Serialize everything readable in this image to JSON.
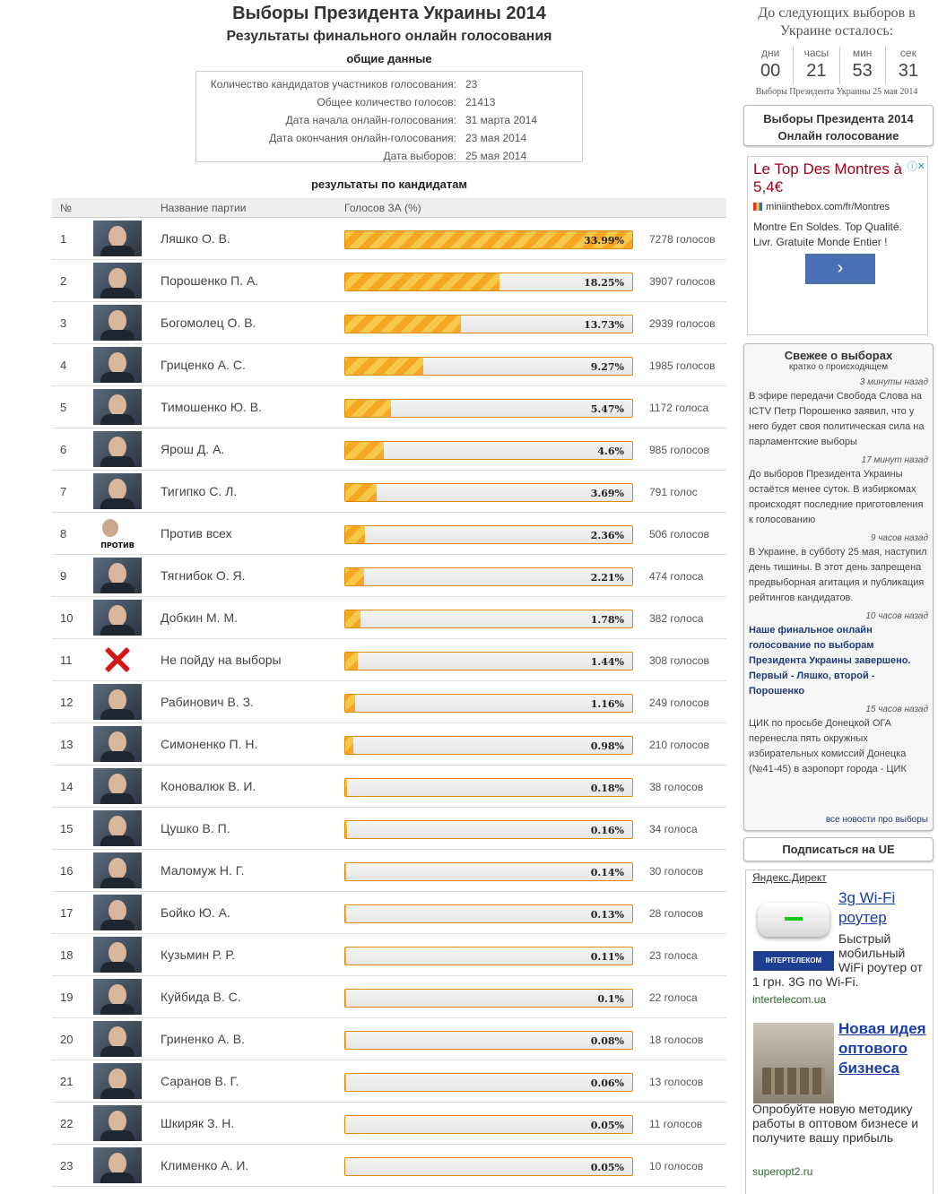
{
  "header": {
    "title": "Выборы Президента Украины 2014",
    "subtitle": "Результаты финального онлайн голосования",
    "general_label": "общие данные",
    "results_label": "результаты по кандидатам"
  },
  "general": [
    {
      "k": "Количество кандидатов участников голосования:",
      "v": "23"
    },
    {
      "k": "Общее количество голосов:",
      "v": "21413"
    },
    {
      "k": "Дата начала онлайн-голосования:",
      "v": "31 марта 2014"
    },
    {
      "k": "Дата окончания онлайн-голосования:",
      "v": "23 мая 2014"
    },
    {
      "k": "Дата выборов:",
      "v": "25 мая 2014"
    }
  ],
  "table": {
    "col_num": "№",
    "col_party": "Название партии",
    "col_votes": "Голосов ЗА (%)"
  },
  "candidates": [
    {
      "num": "1",
      "name": "Ляшко О. В.",
      "pct": 33.99,
      "pct_label": "33.99%",
      "votes": "7278 голосов"
    },
    {
      "num": "2",
      "name": "Порошенко П. А.",
      "pct": 18.25,
      "pct_label": "18.25%",
      "votes": "3907 голосов"
    },
    {
      "num": "3",
      "name": "Богомолец О. В.",
      "pct": 13.73,
      "pct_label": "13.73%",
      "votes": "2939 голосов"
    },
    {
      "num": "4",
      "name": "Гриценко А. С.",
      "pct": 9.27,
      "pct_label": "9.27%",
      "votes": "1985 голосов"
    },
    {
      "num": "5",
      "name": "Тимошенко Ю. В.",
      "pct": 5.47,
      "pct_label": "5.47%",
      "votes": "1172 голоса"
    },
    {
      "num": "6",
      "name": "Ярош Д. А.",
      "pct": 4.6,
      "pct_label": "4.6%",
      "votes": "985 голосов"
    },
    {
      "num": "7",
      "name": "Тигипко С. Л.",
      "pct": 3.69,
      "pct_label": "3.69%",
      "votes": "791 голос"
    },
    {
      "num": "8",
      "name": "Против всех",
      "pct": 2.36,
      "pct_label": "2.36%",
      "votes": "506 голосов",
      "photo": "against"
    },
    {
      "num": "9",
      "name": "Тягнибок О. Я.",
      "pct": 2.21,
      "pct_label": "2.21%",
      "votes": "474 голоса"
    },
    {
      "num": "10",
      "name": "Добкин М. М.",
      "pct": 1.78,
      "pct_label": "1.78%",
      "votes": "382 голоса"
    },
    {
      "num": "11",
      "name": "Не пойду на выборы",
      "pct": 1.44,
      "pct_label": "1.44%",
      "votes": "308 голосов",
      "photo": "red-x"
    },
    {
      "num": "12",
      "name": "Рабинович В. З.",
      "pct": 1.16,
      "pct_label": "1.16%",
      "votes": "249 голосов"
    },
    {
      "num": "13",
      "name": "Симоненко П. Н.",
      "pct": 0.98,
      "pct_label": "0.98%",
      "votes": "210 голосов"
    },
    {
      "num": "14",
      "name": "Коновалюк В. И.",
      "pct": 0.18,
      "pct_label": "0.18%",
      "votes": "38 голосов"
    },
    {
      "num": "15",
      "name": "Цушко В. П.",
      "pct": 0.16,
      "pct_label": "0.16%",
      "votes": "34 голоса"
    },
    {
      "num": "16",
      "name": "Маломуж Н. Г.",
      "pct": 0.14,
      "pct_label": "0.14%",
      "votes": "30 голосов"
    },
    {
      "num": "17",
      "name": "Бойко Ю. А.",
      "pct": 0.13,
      "pct_label": "0.13%",
      "votes": "28 голосов"
    },
    {
      "num": "18",
      "name": "Кузьмин Р. Р.",
      "pct": 0.11,
      "pct_label": "0.11%",
      "votes": "23 голоса"
    },
    {
      "num": "19",
      "name": "Куйбида В. С.",
      "pct": 0.1,
      "pct_label": "0.1%",
      "votes": "22 голоса"
    },
    {
      "num": "20",
      "name": "Гриненко А. В.",
      "pct": 0.08,
      "pct_label": "0.08%",
      "votes": "18 голосов"
    },
    {
      "num": "21",
      "name": "Саранов В. Г.",
      "pct": 0.06,
      "pct_label": "0.06%",
      "votes": "13 голосов"
    },
    {
      "num": "22",
      "name": "Шкиряк З. Н.",
      "pct": 0.05,
      "pct_label": "0.05%",
      "votes": "11 голосов"
    },
    {
      "num": "23",
      "name": "Клименко А. И.",
      "pct": 0.05,
      "pct_label": "0.05%",
      "votes": "10 голосов"
    }
  ],
  "against_caption": "ПРОТИВ ВСЕХ",
  "sidebar": {
    "countdown_title": "До следующих выборов в Украине осталось:",
    "countdown": [
      {
        "unit": "дни",
        "value": "00"
      },
      {
        "unit": "часы",
        "value": "21"
      },
      {
        "unit": "мин",
        "value": "53"
      },
      {
        "unit": "сек",
        "value": "31"
      }
    ],
    "countdown_caption": "Выборы Президента Украины 25 мая 2014",
    "vote_box": "Выборы Президента 2014 Онлайн голосование",
    "ad": {
      "title": "Le Top Des Montres à 5,4€",
      "url": "miniinthebox.com/fr/Montres",
      "text": "Montre En Soldes. Top Qualité. Livr. Gratuite Monde Entier !",
      "go": "›",
      "close": "ⓘ✕"
    },
    "news_title": "Свежее о выборах",
    "news_sub": "кратко о происходящем",
    "news": [
      {
        "time": "3 минуты назад",
        "text": "В эфире передачи Свобода Слова на ICTV Петр Порошенко заявил, что у него будет своя политическая сила на парламентские выборы",
        "bold": false
      },
      {
        "time": "17 минут назад",
        "text": "До выборов Президента Украины остаётся менее суток. В избиркомах происходят последние приготовления к голосованию",
        "bold": false
      },
      {
        "time": "9 часов назад",
        "text": "В Украине, в субботу 25 мая, наступил день тишины. В этот день запрещена предвыборная агитация и публикация рейтингов кандидатов.",
        "bold": false
      },
      {
        "time": "10 часов назад",
        "text": "Наше финальное онлайн голосование по выборам Президента Украины завершено. Первый - Ляшко, второй - Порошенко",
        "bold": true
      },
      {
        "time": "15 часов назад",
        "text": "ЦИК по просьбе Донецкой ОГА перенесла пять окружных избирательных комиссий Донецка (№41-45) в аэропорт города - ЦИК",
        "bold": false
      }
    ],
    "news_all": "все новости про выборы",
    "subscribe": "Подписаться на UE",
    "direct_label": "Яндекс.Директ",
    "ad1": {
      "title": "3g Wi-Fi роутер",
      "logo": "ІНТЕРТЕЛЕКОМ",
      "text": "Быстрый мобильный WiFi роутер от",
      "text2": "1 грн. 3G по Wi-Fi.",
      "url": "intertelecom.ua"
    },
    "ad2": {
      "title": "Новая идея оптового бизнеса",
      "text": "Опробуйте новую методику работы в оптовом бизнесе и получите вашу прибыль",
      "url": "superopt2.ru"
    }
  },
  "colors": {
    "bar_border": "#e08a00",
    "bar_stripe_a": "#f5a623",
    "bar_stripe_b": "#f7c84a",
    "link_blue": "#1a3ea8"
  }
}
